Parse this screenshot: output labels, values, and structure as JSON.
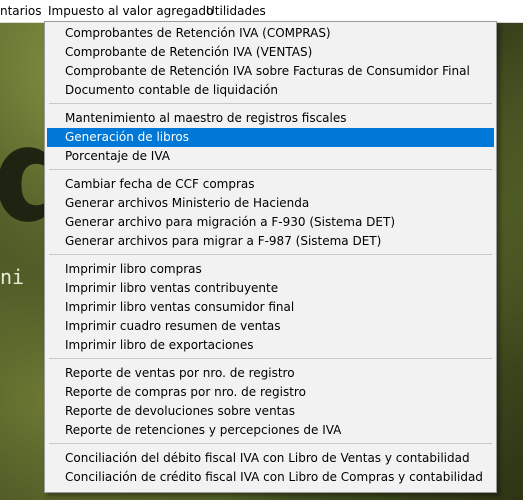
{
  "background": {
    "letters": "de",
    "subtext": "ni"
  },
  "menubar": {
    "items": [
      "ntarios",
      "Impuesto al valor agregado",
      "Utilidades"
    ]
  },
  "menu": {
    "selected_label": "Generación de libros",
    "groups": [
      {
        "items": [
          "Comprobantes de Retención IVA (COMPRAS)",
          "Comprobante de Retención IVA (VENTAS)",
          "Comprobante de Retención IVA sobre Facturas de Consumidor Final",
          "Documento contable de liquidación"
        ]
      },
      {
        "items": [
          "Mantenimiento al maestro de registros fiscales",
          "Generación de libros",
          "Porcentaje de IVA"
        ]
      },
      {
        "items": [
          "Cambiar fecha de CCF compras",
          "Generar archivos Ministerio de Hacienda",
          "Generar archivo para migración a F-930 (Sistema DET)",
          "Generar archivos  para migrar a F-987 (Sistema DET)"
        ]
      },
      {
        "items": [
          "Imprimir libro compras",
          "Imprimir libro ventas contribuyente",
          "Imprimir libro ventas consumidor final",
          "Imprimir cuadro resumen de ventas",
          "Imprimir libro de exportaciones"
        ]
      },
      {
        "items": [
          "Reporte de ventas por nro. de registro",
          "Reporte de compras por nro. de registro",
          "Reporte de devoluciones sobre ventas",
          "Reporte de retenciones y percepciones de IVA"
        ]
      },
      {
        "items": [
          "Conciliación del débito fiscal IVA con Libro de Ventas y contabilidad",
          "Conciliación de crédito fiscal IVA con Libro de Compras y contabilidad"
        ]
      }
    ]
  }
}
